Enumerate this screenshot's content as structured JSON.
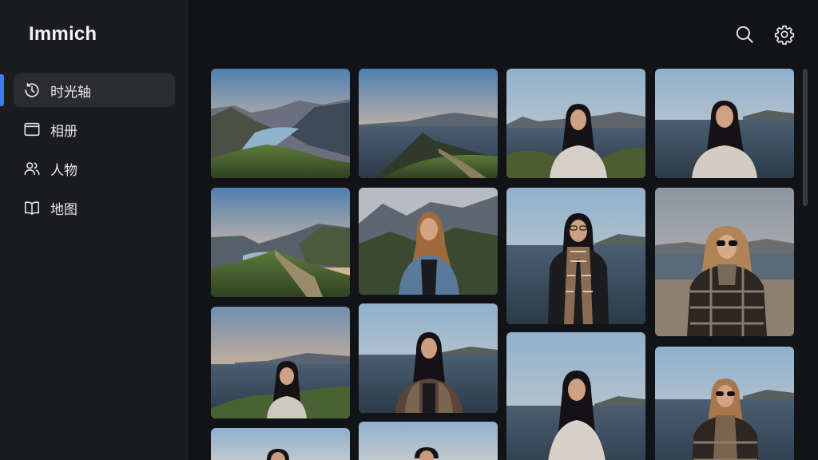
{
  "app": {
    "title": "Immich"
  },
  "sidebar": {
    "items": [
      {
        "label": "时光轴",
        "icon": "timeline-icon",
        "active": true
      },
      {
        "label": "相册",
        "icon": "album-icon",
        "active": false
      },
      {
        "label": "人物",
        "icon": "people-icon",
        "active": false
      },
      {
        "label": "地图",
        "icon": "map-icon",
        "active": false
      }
    ]
  },
  "toolbar": {
    "search_icon": "search-icon",
    "settings_icon": "gear-icon"
  },
  "colors": {
    "background": "#121316",
    "sidebar": "#1b1c1f",
    "accent": "#3d7bf5",
    "active_item": "#2b2c30"
  },
  "photos": [
    {
      "kind": "landscape-fjord"
    },
    {
      "kind": "landscape-sea-mountain"
    },
    {
      "kind": "portrait-sea"
    },
    {
      "kind": "portrait-sea"
    },
    {
      "kind": "landscape-valley"
    },
    {
      "kind": "portrait-mountain"
    },
    {
      "kind": "portrait-sea-glasses"
    },
    {
      "kind": "portrait-beach-sunglasses"
    },
    {
      "kind": "portrait-sunset-sea"
    },
    {
      "kind": "portrait-sea-plaid"
    },
    {
      "kind": "portrait-sea"
    },
    {
      "kind": "portrait-sea-sunglasses"
    },
    {
      "kind": "partial-portrait"
    },
    {
      "kind": "partial-portrait"
    }
  ]
}
